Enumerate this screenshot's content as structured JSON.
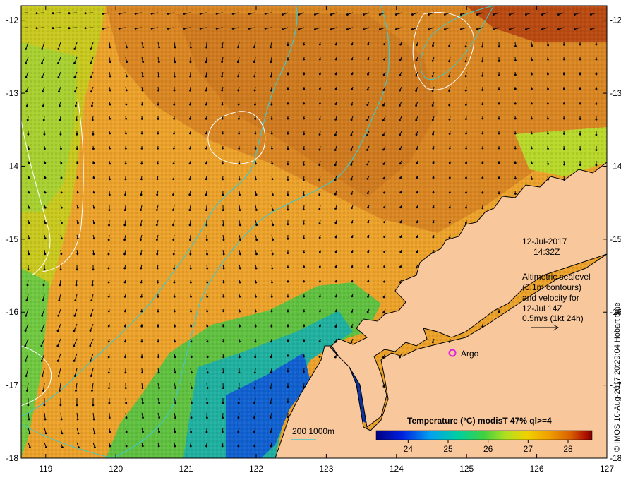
{
  "map": {
    "lon_ticks": [
      "119",
      "120",
      "121",
      "122",
      "123",
      "124",
      "125",
      "126",
      "127"
    ],
    "lat_ticks": [
      "-12",
      "-13",
      "-14",
      "-15",
      "-16",
      "-17",
      "-18"
    ],
    "lon_range": [
      118.65,
      127.0
    ],
    "lat_range": [
      -18.0,
      -11.8
    ]
  },
  "annotations": {
    "date": "12-Jul-2017",
    "time": "14:32Z",
    "desc_1": "Altimetric sealevel",
    "desc_2": "(0.1m contours)",
    "desc_3": "and velocity for",
    "desc_4": "12-Jul 14Z",
    "scale_text": "0.5m/s (1kt 24h)",
    "argo_label": "Argo",
    "bathy_label": "200  1000m",
    "credit": "© IMOS 10-Aug-2017 20:29:04 Hobart time"
  },
  "colorbar": {
    "title": "Temperature (°C) modisT 47% ql>=4",
    "ticks": [
      "24",
      "25",
      "26",
      "27",
      "28"
    ],
    "range": [
      23.2,
      28.6
    ]
  },
  "colors": {
    "land": "#f8c89c",
    "bathy": "#40c8c8",
    "argo": "#e020e0",
    "warm": "#d47810",
    "mid": "#f0a800",
    "cool": "#80d040"
  }
}
